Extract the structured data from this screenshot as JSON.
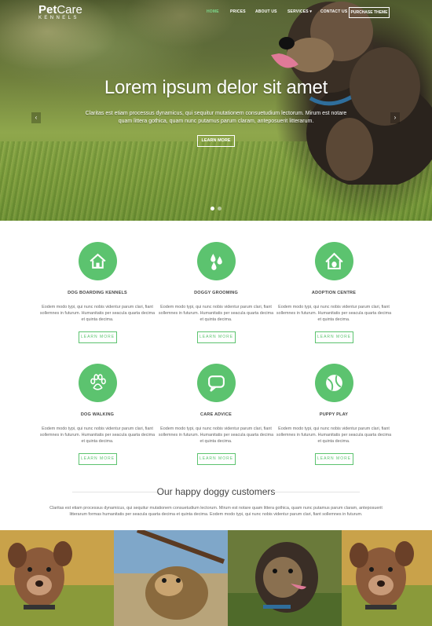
{
  "brand": {
    "name_bold": "Pet",
    "name_light": "Care",
    "tagline": "KENNELS"
  },
  "nav": {
    "items": [
      "HOME",
      "PRICES",
      "ABOUT US",
      "SERVICES ▾",
      "CONTACT US"
    ],
    "active_index": 0,
    "purchase_label": "PURCHASE THEME"
  },
  "hero": {
    "title": "Lorem ipsum delor sit amet",
    "text": "Claritas est etiam processus dynamicus, qui sequitur mutationem consuetudium lectorum. Mirum est notare quam littera gothica, quam nunc putamus parum claram, anteposuerit litterarum.",
    "button": "LEARN MORE",
    "prev_icon": "‹",
    "next_icon": "›",
    "slides": 2,
    "active_slide": 0
  },
  "services": [
    {
      "title": "DOG BOARDING KENNELS",
      "icon": "house-icon",
      "desc": "Eodem modo typi, qui nunc nobis videntur parum clari, fiant sollemnes in futurum. Humanitatis per seacula quarta decima et quinta decima.",
      "button": "LEARN MORE"
    },
    {
      "title": "DOGGY GROOMING",
      "icon": "water-drops-icon",
      "desc": "Eodem modo typi, qui nunc nobis videntur parum clari, fiant sollemnes in futurum. Humanitatis per seacula quarta decima et quinta decima.",
      "button": "LEARN MORE"
    },
    {
      "title": "ADOPTION CENTRE",
      "icon": "dog-house-icon",
      "desc": "Eodem modo typi, qui nunc nobis videntur parum clari, fiant sollemnes in futurum. Humanitatis per seacula quarta decima et quinta decima.",
      "button": "LEARN MORE"
    },
    {
      "title": "DOG WALKING",
      "icon": "paw-icon",
      "desc": "Eodem modo typi, qui nunc nobis videntur parum clari, fiant sollemnes in futurum. Humanitatis per seacula quarta decima et quinta decima.",
      "button": "LEARN MORE"
    },
    {
      "title": "CARE ADVICE",
      "icon": "speech-bubble-icon",
      "desc": "Eodem modo typi, qui nunc nobis videntur parum clari, fiant sollemnes in futurum. Humanitatis per seacula quarta decima et quinta decima.",
      "button": "LEARN MORE"
    },
    {
      "title": "PUPPY PLAY",
      "icon": "ball-icon",
      "desc": "Eodem modo typi, qui nunc nobis videntur parum clari, fiant sollemnes in futurum. Humanitatis per seacula quarta decima et quinta decima.",
      "button": "LEARN MORE"
    }
  ],
  "happy": {
    "title": "Our happy doggy customers",
    "text": "Claritas est etiam processus dynamicus, qui sequitur mutationem consuetudium lectorum. Mirum est notare quam littera gothica, quam nunc putamus parum claram, anteposuerit litterarum formas humanitatis per seacula quarta decima et quinta decima. Eodem modo typi, qui nunc nobis videntur parum clari, fiant sollemnes in futurum."
  },
  "colors": {
    "accent": "#5cc36f",
    "text": "#555555",
    "heading": "#444444"
  }
}
